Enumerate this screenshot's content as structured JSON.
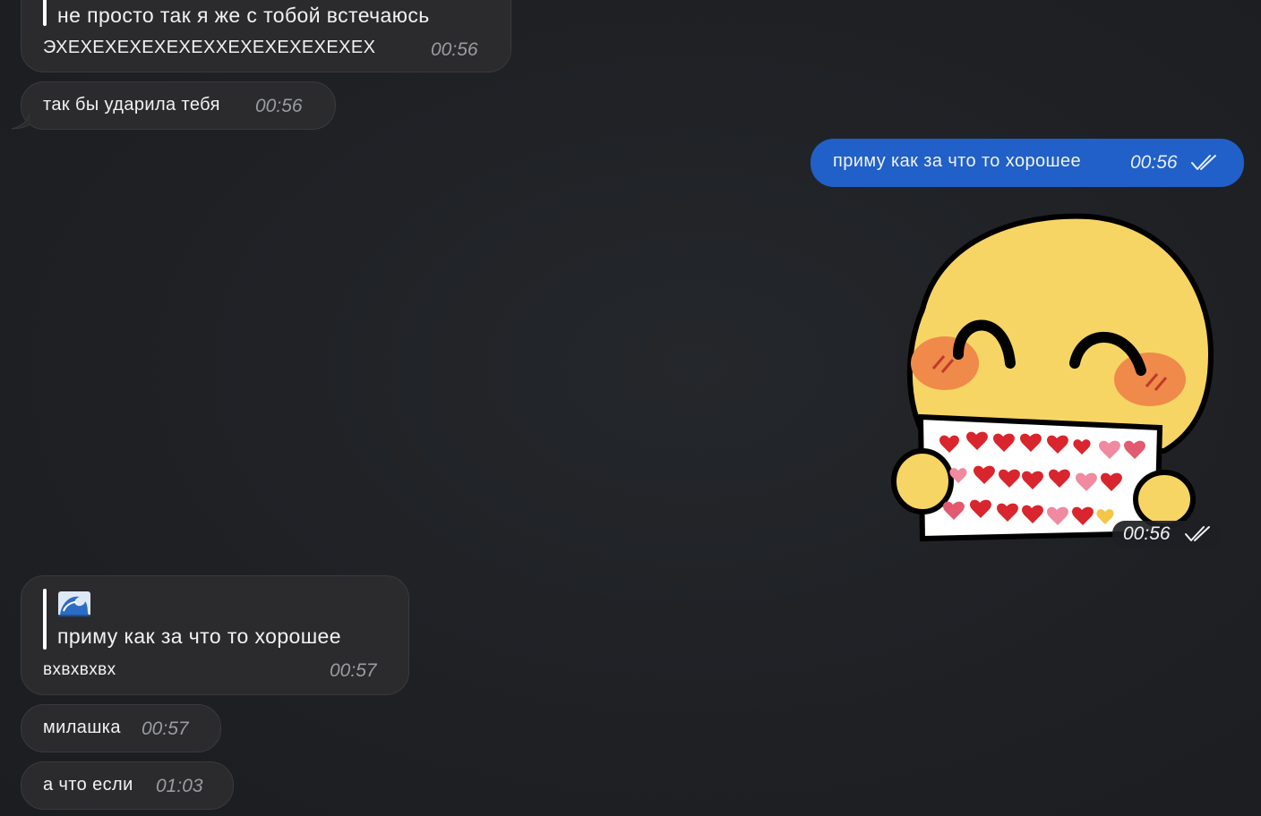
{
  "colors": {
    "background": "#1e2024",
    "incoming_bubble": "#2b2b2d",
    "outgoing_bubble": "#2060c8",
    "time_incoming": "#9a9ca0"
  },
  "messages": [
    {
      "direction": "incoming",
      "quote": "не просто так я же с тобой встечаюсь",
      "text": "ЭХЕХЕХЕХЕХЕХЕХХЕХЕХЕХЕХЕХЕХ",
      "time": "00:56"
    },
    {
      "direction": "incoming",
      "text": "так бы ударила тебя",
      "time": "00:56"
    },
    {
      "direction": "outgoing",
      "text": "приму как за что то хорошее",
      "time": "00:56",
      "status_icon": "double-check-icon"
    },
    {
      "direction": "outgoing",
      "type": "sticker",
      "sticker_icon": "blushing-smiley-holding-hearts-sign",
      "time": "00:56",
      "status_icon": "double-check-icon"
    },
    {
      "direction": "incoming",
      "quote_emoji_icon": "water-wave-icon",
      "quote": "приму как за что то хорошее",
      "text": "вхвхвхвх",
      "time": "00:57"
    },
    {
      "direction": "incoming",
      "text": "милашка",
      "time": "00:57"
    },
    {
      "direction": "incoming",
      "text": "а что если",
      "time": "01:03"
    }
  ]
}
